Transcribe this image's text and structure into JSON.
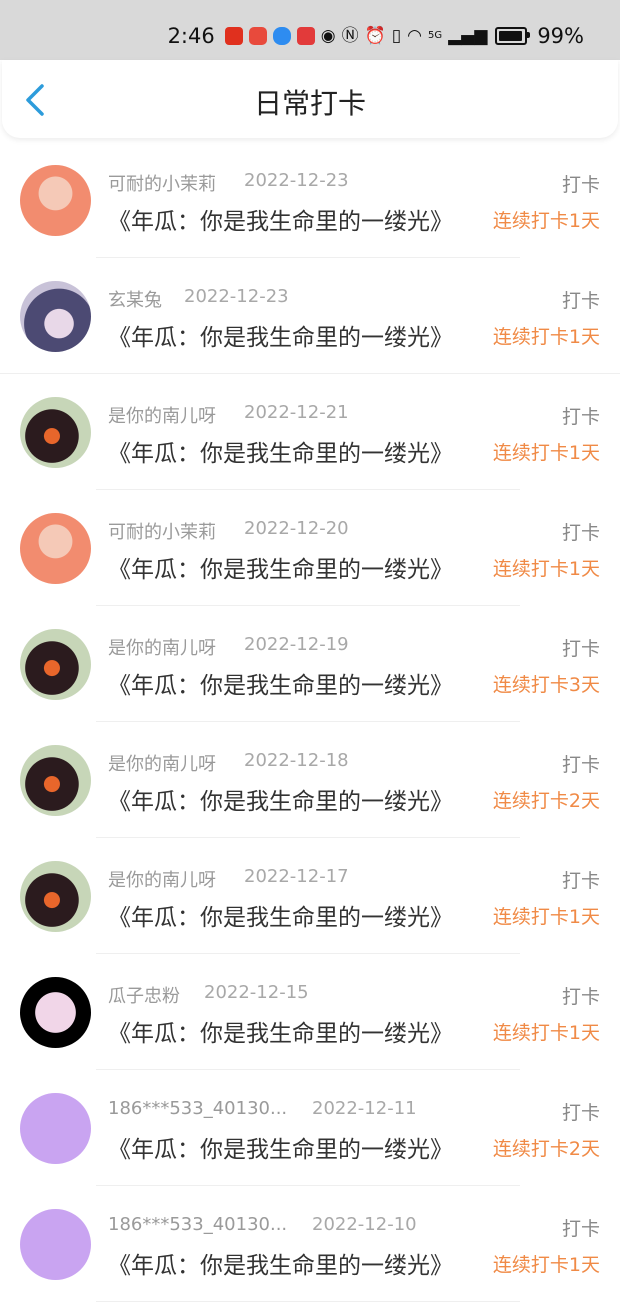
{
  "status_bar": {
    "time": "2:46",
    "battery": "99%",
    "network": "5G"
  },
  "header": {
    "title": "日常打卡",
    "back_icon": "chevron-left-icon"
  },
  "colors": {
    "accent": "#2d9cdb",
    "streak": "#f08a46"
  },
  "entries": [
    {
      "name": "可耐的小茉莉",
      "date": "2022-12-23",
      "content": "《年瓜：你是我生命里的一缕光》",
      "tag": "打卡",
      "streak": "连续打卡1天"
    },
    {
      "name": "玄某兔",
      "date": "2022-12-23",
      "content": "《年瓜：你是我生命里的一缕光》",
      "tag": "打卡",
      "streak": "连续打卡1天"
    },
    {
      "name": "是你的南儿呀",
      "date": "2022-12-21",
      "content": "《年瓜：你是我生命里的一缕光》",
      "tag": "打卡",
      "streak": "连续打卡1天"
    },
    {
      "name": "可耐的小茉莉",
      "date": "2022-12-20",
      "content": "《年瓜：你是我生命里的一缕光》",
      "tag": "打卡",
      "streak": "连续打卡1天"
    },
    {
      "name": "是你的南儿呀",
      "date": "2022-12-19",
      "content": "《年瓜：你是我生命里的一缕光》",
      "tag": "打卡",
      "streak": "连续打卡3天"
    },
    {
      "name": "是你的南儿呀",
      "date": "2022-12-18",
      "content": "《年瓜：你是我生命里的一缕光》",
      "tag": "打卡",
      "streak": "连续打卡2天"
    },
    {
      "name": "是你的南儿呀",
      "date": "2022-12-17",
      "content": "《年瓜：你是我生命里的一缕光》",
      "tag": "打卡",
      "streak": "连续打卡1天"
    },
    {
      "name": "瓜子忠粉",
      "date": "2022-12-15",
      "content": "《年瓜：你是我生命里的一缕光》",
      "tag": "打卡",
      "streak": "连续打卡1天"
    },
    {
      "name": "186***533_40130...",
      "date": "2022-12-11",
      "content": "《年瓜：你是我生命里的一缕光》",
      "tag": "打卡",
      "streak": "连续打卡2天"
    },
    {
      "name": "186***533_40130...",
      "date": "2022-12-10",
      "content": "《年瓜：你是我生命里的一缕光》",
      "tag": "打卡",
      "streak": "连续打卡1天"
    }
  ]
}
